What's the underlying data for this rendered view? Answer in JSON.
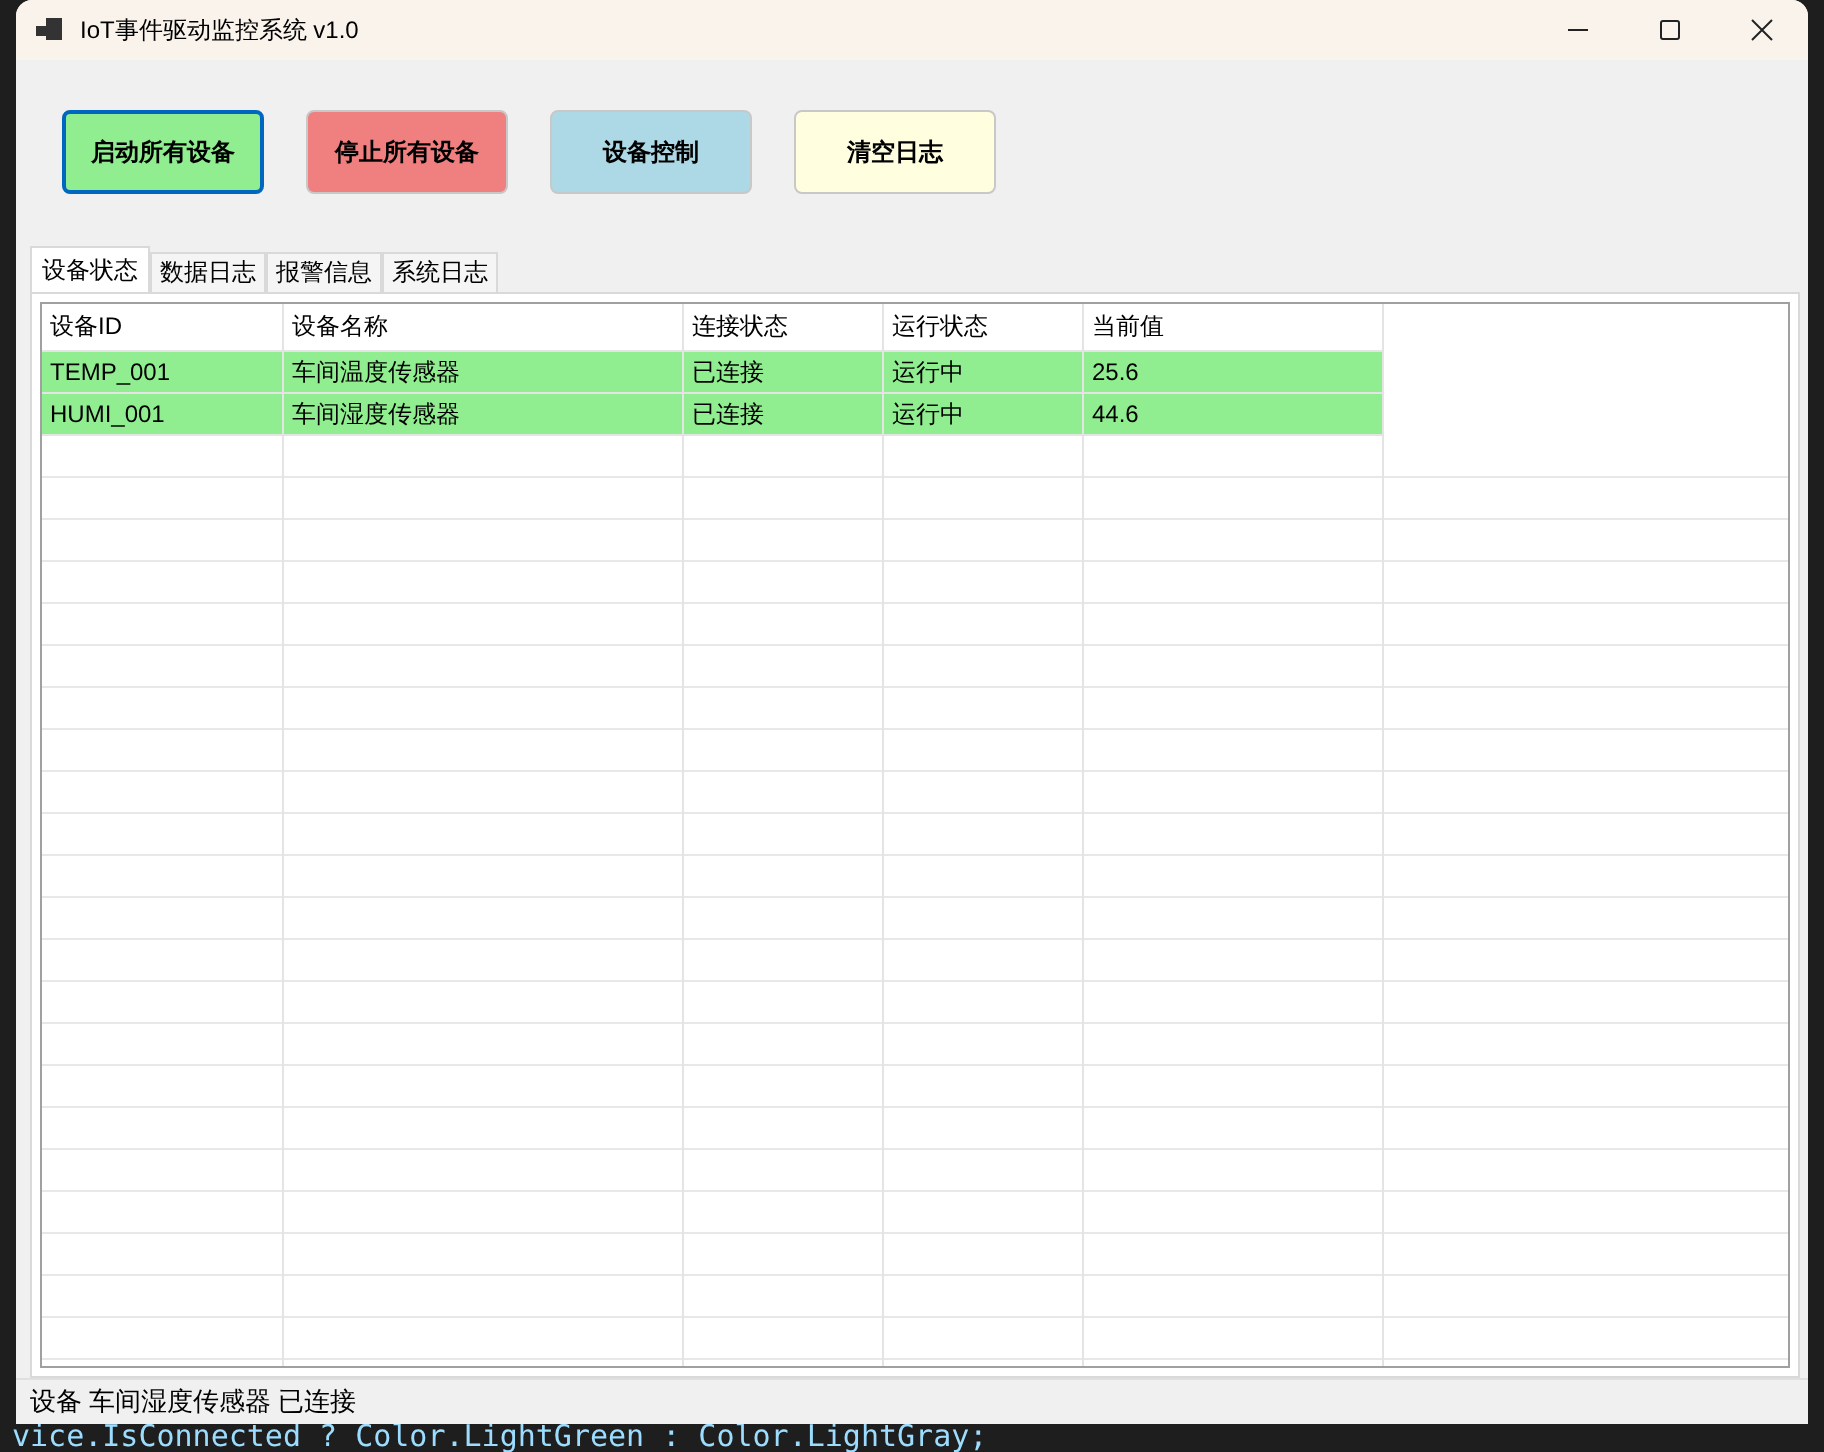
{
  "window": {
    "title": "IoT事件驱动监控系统 v1.0"
  },
  "buttons": [
    {
      "label": "启动所有设备",
      "color": "#90ee90",
      "focused": true
    },
    {
      "label": "停止所有设备",
      "color": "#f08080",
      "focused": false
    },
    {
      "label": "设备控制",
      "color": "#add8e6",
      "focused": false
    },
    {
      "label": "清空日志",
      "color": "#ffffe0",
      "focused": false
    }
  ],
  "tabs": [
    {
      "label": "设备状态",
      "selected": true
    },
    {
      "label": "数据日志",
      "selected": false
    },
    {
      "label": "报警信息",
      "selected": false
    },
    {
      "label": "系统日志",
      "selected": false
    }
  ],
  "table": {
    "columns": [
      "设备ID",
      "设备名称",
      "连接状态",
      "运行状态",
      "当前值"
    ],
    "rows": [
      {
        "cells": [
          "TEMP_001",
          "车间温度传感器",
          "已连接",
          "运行中",
          "25.6"
        ],
        "color": "#90ee90"
      },
      {
        "cells": [
          "HUMI_001",
          "车间湿度传感器",
          "已连接",
          "运行中",
          "44.6"
        ],
        "color": "#90ee90"
      }
    ]
  },
  "status_bar": "设备 车间湿度传感器 已连接",
  "backdrop": {
    "code_line": "vice.IsConnected ? Color.LightGreen : Color.LightGray;"
  }
}
